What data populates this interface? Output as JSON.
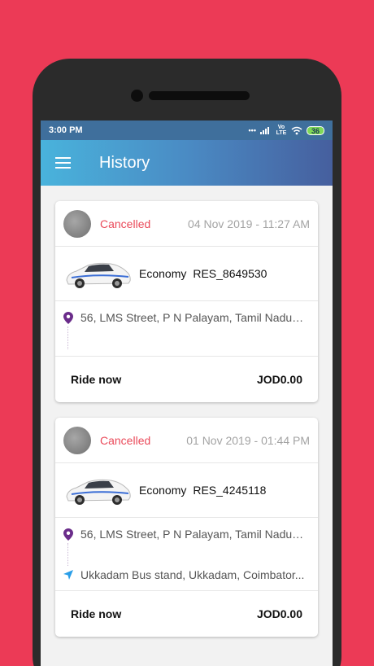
{
  "status_bar": {
    "time": "3:00 PM",
    "network": "Vo LTE",
    "battery": "36"
  },
  "toolbar": {
    "title": "History"
  },
  "rides": [
    {
      "status": "Cancelled",
      "date": "04 Nov 2019 - 11:27 AM",
      "car_type": "Economy",
      "ride_id": "RES_8649530",
      "pickup": "56, LMS Street, P N Palayam, Tamil Nadu, ...",
      "drop": "",
      "ride_label": "Ride now",
      "price": "JOD0.00"
    },
    {
      "status": "Cancelled",
      "date": "01 Nov 2019 - 01:44 PM",
      "car_type": "Economy",
      "ride_id": "RES_4245118",
      "pickup": "56, LMS Street, P N Palayam, Tamil Nadu, ...",
      "drop": "Ukkadam Bus stand, Ukkadam, Coimbator...",
      "ride_label": "Ride now",
      "price": "JOD0.00"
    }
  ],
  "colors": {
    "background": "#ec3a56",
    "cancelled": "#ea4a5a",
    "pickup_pin": "#6a2c8a",
    "drop_arrow": "#2a9ee8"
  },
  "icons": {
    "menu": "hamburger-menu-icon",
    "pickup": "location-pin-icon",
    "drop": "navigation-arrow-icon"
  }
}
